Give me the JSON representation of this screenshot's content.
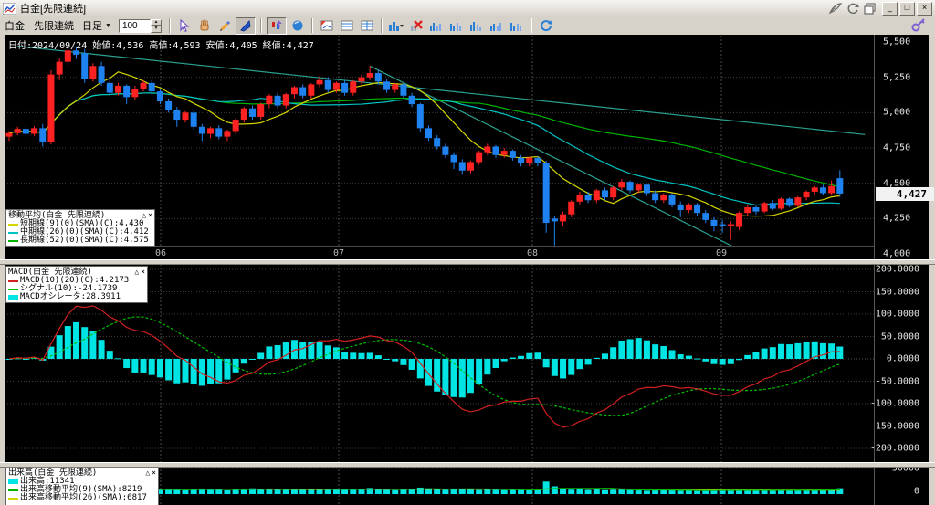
{
  "window": {
    "title": "白金[先限連続]",
    "minimize": "_",
    "maximize": "□",
    "close": "×"
  },
  "toolbar": {
    "symbol": "白金",
    "contract": "先限連続",
    "period": "日足",
    "period_caret": "▼",
    "bars_value": "100"
  },
  "info_bar": {
    "text": "日付:2024/09/24 始値:4,536 高値:4,593 安値:4,405 終値:4,427"
  },
  "main_pane": {
    "price_box": "4,427",
    "y_ticks": [
      {
        "label": "5,500",
        "price": 5500
      },
      {
        "label": "5,250",
        "price": 5250
      },
      {
        "label": "5,000",
        "price": 5000
      },
      {
        "label": "4,750",
        "price": 4750
      },
      {
        "label": "4,500",
        "price": 4500
      },
      {
        "label": "4,250",
        "price": 4250
      },
      {
        "label": "4,000",
        "price": 4000
      }
    ],
    "x_ticks": [
      {
        "label": "06",
        "x": 176
      },
      {
        "label": "07",
        "x": 371
      },
      {
        "label": "08",
        "x": 583
      },
      {
        "label": "09",
        "x": 790
      }
    ],
    "ma_legend": {
      "title": "移動平均(白金 先限連続)",
      "collapse": "△",
      "close": "×",
      "rows": [
        {
          "label": "短期線(9)(0)(SMA)(C):4,430",
          "color": "#d6d600"
        },
        {
          "label": "中期線(26)(0)(SMA)(C):4,412",
          "color": "#00c2c2"
        },
        {
          "label": "長期線(52)(0)(SMA)(C):4,575",
          "color": "#00b400"
        }
      ]
    }
  },
  "macd_pane": {
    "legend": {
      "title": "MACD(白金 先限連続)",
      "collapse": "△",
      "close": "×",
      "rows": [
        {
          "label": "MACD(10)(20)(C):4.2173",
          "color": "#d02020"
        },
        {
          "label": "シグナル(10):-24.1739",
          "color": "#00c000"
        },
        {
          "label": "MACDオシレータ:28.3911",
          "color": "#00e4e4"
        }
      ]
    },
    "y_ticks": [
      {
        "label": "200.0000",
        "value": 200
      },
      {
        "label": "150.0000",
        "value": 150
      },
      {
        "label": "100.0000",
        "value": 100
      },
      {
        "label": "50.0000",
        "value": 50
      },
      {
        "label": "0.0000",
        "value": 0
      },
      {
        "label": "-50.0000",
        "value": -50
      },
      {
        "label": "-100.0000",
        "value": -100
      },
      {
        "label": "-150.0000",
        "value": -150
      },
      {
        "label": "-200.0000",
        "value": -200
      }
    ]
  },
  "volume_pane": {
    "legend": {
      "title": "出来高(白金 先限連続)",
      "collapse": "△",
      "close": "×",
      "rows": [
        {
          "label": "出来高:11341",
          "color": "#00e4e4"
        },
        {
          "label": "出来高移動平均(9)(SMA):8219",
          "color": "#00b400"
        },
        {
          "label": "出来高移動平均(26)(SMA):6817",
          "color": "#d6d600"
        }
      ]
    },
    "y_ticks": [
      {
        "label": "50000",
        "value": 50000
      },
      {
        "label": "0",
        "value": 0
      }
    ]
  },
  "chart_data": {
    "type": "candlestick",
    "instrument": "白金 先限連続 日足",
    "last_date": "2024/09/24",
    "last_ohlc": {
      "open": 4536,
      "high": 4593,
      "low": 4405,
      "close": 4427
    },
    "price_axis": {
      "min": 4000,
      "max": 5500,
      "grid": 250
    },
    "macd_axis": {
      "min": -200,
      "max": 200,
      "grid": 50
    },
    "volume_axis": {
      "min": 0,
      "max": 50000
    },
    "colors": {
      "up": "#ff2222",
      "down": "#1e82f0",
      "sma9": "#d6d600",
      "sma26": "#00c2c2",
      "sma52": "#00b400",
      "macd": "#d02020",
      "signal": "#00c000",
      "hist": "#00e4e4",
      "volume": "#00e4e4",
      "trendline": "#2aa090",
      "grid": "#3c3c3c"
    },
    "trendlines": [
      {
        "from_bar": 1,
        "from_price": 5470,
        "to_bar": 102,
        "to_price": 4845
      },
      {
        "from_bar": 43,
        "from_price": 5330,
        "to_bar": 87,
        "to_price": 4030
      }
    ],
    "candles": [
      [
        4830,
        4870,
        4800,
        4855
      ],
      [
        4855,
        4900,
        4840,
        4885
      ],
      [
        4885,
        4910,
        4830,
        4850
      ],
      [
        4850,
        4905,
        4835,
        4890
      ],
      [
        4890,
        4920,
        4760,
        4790
      ],
      [
        4790,
        5300,
        4775,
        5270
      ],
      [
        5270,
        5390,
        5230,
        5360
      ],
      [
        5360,
        5480,
        5330,
        5440
      ],
      [
        5440,
        5470,
        5380,
        5410
      ],
      [
        5420,
        5450,
        5210,
        5240
      ],
      [
        5240,
        5350,
        5220,
        5330
      ],
      [
        5330,
        5360,
        5190,
        5210
      ],
      [
        5210,
        5250,
        5120,
        5140
      ],
      [
        5140,
        5210,
        5120,
        5190
      ],
      [
        5190,
        5200,
        5060,
        5110
      ],
      [
        5110,
        5190,
        5090,
        5170
      ],
      [
        5170,
        5230,
        5150,
        5210
      ],
      [
        5210,
        5230,
        5130,
        5150
      ],
      [
        5150,
        5170,
        5060,
        5080
      ],
      [
        5080,
        5100,
        5000,
        5020
      ],
      [
        5020,
        5040,
        4900,
        4950
      ],
      [
        4950,
        5010,
        4930,
        5000
      ],
      [
        5000,
        5010,
        4880,
        4900
      ],
      [
        4900,
        4920,
        4800,
        4850
      ],
      [
        4850,
        4900,
        4820,
        4890
      ],
      [
        4890,
        4910,
        4810,
        4830
      ],
      [
        4830,
        4880,
        4800,
        4870
      ],
      [
        4870,
        4960,
        4850,
        4950
      ],
      [
        4950,
        5040,
        4930,
        5030
      ],
      [
        5030,
        5050,
        4950,
        4970
      ],
      [
        4970,
        5070,
        4950,
        5060
      ],
      [
        5060,
        5130,
        5030,
        5120
      ],
      [
        5120,
        5140,
        5030,
        5050
      ],
      [
        5050,
        5140,
        5030,
        5130
      ],
      [
        5130,
        5190,
        5100,
        5180
      ],
      [
        5180,
        5200,
        5100,
        5120
      ],
      [
        5120,
        5210,
        5100,
        5200
      ],
      [
        5200,
        5260,
        5180,
        5230
      ],
      [
        5230,
        5250,
        5140,
        5160
      ],
      [
        5160,
        5220,
        5140,
        5210
      ],
      [
        5210,
        5230,
        5120,
        5140
      ],
      [
        5140,
        5230,
        5120,
        5220
      ],
      [
        5220,
        5270,
        5200,
        5250
      ],
      [
        5250,
        5330,
        5230,
        5280
      ],
      [
        5280,
        5300,
        5200,
        5220
      ],
      [
        5220,
        5240,
        5140,
        5160
      ],
      [
        5160,
        5210,
        5140,
        5200
      ],
      [
        5200,
        5210,
        5100,
        5120
      ],
      [
        5120,
        5140,
        5040,
        5060
      ],
      [
        5060,
        5070,
        4860,
        4890
      ],
      [
        4890,
        4910,
        4800,
        4820
      ],
      [
        4820,
        4840,
        4740,
        4760
      ],
      [
        4760,
        4780,
        4680,
        4700
      ],
      [
        4700,
        4720,
        4600,
        4650
      ],
      [
        4650,
        4670,
        4560,
        4590
      ],
      [
        4590,
        4660,
        4570,
        4650
      ],
      [
        4650,
        4730,
        4630,
        4720
      ],
      [
        4720,
        4780,
        4700,
        4760
      ],
      [
        4760,
        4770,
        4680,
        4700
      ],
      [
        4700,
        4750,
        4680,
        4730
      ],
      [
        4730,
        4740,
        4660,
        4680
      ],
      [
        4680,
        4700,
        4620,
        4640
      ],
      [
        4640,
        4690,
        4620,
        4680
      ],
      [
        4680,
        4690,
        4620,
        4640
      ],
      [
        4640,
        4660,
        4150,
        4220
      ],
      [
        4250,
        4270,
        4060,
        4230
      ],
      [
        4230,
        4300,
        4200,
        4280
      ],
      [
        4280,
        4380,
        4260,
        4370
      ],
      [
        4370,
        4440,
        4350,
        4420
      ],
      [
        4420,
        4440,
        4360,
        4380
      ],
      [
        4380,
        4460,
        4360,
        4450
      ],
      [
        4450,
        4470,
        4380,
        4400
      ],
      [
        4400,
        4480,
        4380,
        4470
      ],
      [
        4470,
        4530,
        4450,
        4510
      ],
      [
        4510,
        4520,
        4430,
        4450
      ],
      [
        4450,
        4500,
        4430,
        4490
      ],
      [
        4490,
        4500,
        4410,
        4430
      ],
      [
        4430,
        4450,
        4360,
        4380
      ],
      [
        4380,
        4430,
        4360,
        4420
      ],
      [
        4420,
        4430,
        4330,
        4350
      ],
      [
        4350,
        4370,
        4260,
        4310
      ],
      [
        4310,
        4360,
        4290,
        4350
      ],
      [
        4350,
        4360,
        4270,
        4290
      ],
      [
        4290,
        4310,
        4220,
        4240
      ],
      [
        4240,
        4260,
        4160,
        4200
      ],
      [
        4210,
        4240,
        4150,
        4200
      ],
      [
        4200,
        4230,
        4100,
        4210
      ],
      [
        4190,
        4300,
        4170,
        4290
      ],
      [
        4290,
        4350,
        4270,
        4330
      ],
      [
        4330,
        4340,
        4280,
        4300
      ],
      [
        4300,
        4370,
        4290,
        4360
      ],
      [
        4360,
        4380,
        4310,
        4320
      ],
      [
        4320,
        4400,
        4310,
        4390
      ],
      [
        4390,
        4400,
        4330,
        4340
      ],
      [
        4340,
        4410,
        4330,
        4400
      ],
      [
        4400,
        4450,
        4380,
        4440
      ],
      [
        4440,
        4480,
        4420,
        4470
      ],
      [
        4470,
        4490,
        4420,
        4430
      ],
      [
        4430,
        4520,
        4420,
        4480
      ],
      [
        4536,
        4593,
        4405,
        4427
      ]
    ],
    "volumes": [
      9000,
      7500,
      8200,
      10400,
      9800,
      14200,
      12500,
      11000,
      9600,
      8800,
      10200,
      9400,
      8600,
      7800,
      9200,
      8400,
      7600,
      8800,
      9600,
      10400,
      8800,
      7600,
      9200,
      10800,
      9600,
      8400,
      7200,
      8800,
      10400,
      11200,
      9600,
      10800,
      9200,
      8400,
      9800,
      8600,
      9400,
      10200,
      8800,
      9600,
      8200,
      9400,
      10600,
      11800,
      9200,
      8400,
      7600,
      9800,
      10400,
      12600,
      11200,
      9800,
      8600,
      9400,
      10200,
      8800,
      8000,
      9200,
      8400,
      7600,
      8800,
      8000,
      7200,
      8400,
      24500,
      15200,
      9800,
      8600,
      9200,
      8000,
      8800,
      7600,
      8400,
      9200,
      7800,
      7000,
      6400,
      7600,
      8200,
      7000,
      6400,
      7200,
      6000,
      6800,
      7600,
      8400,
      9200,
      8000,
      7200,
      6400,
      7000,
      6200,
      6800,
      7400,
      8200,
      9000,
      9800,
      8600,
      9400,
      11341
    ]
  }
}
